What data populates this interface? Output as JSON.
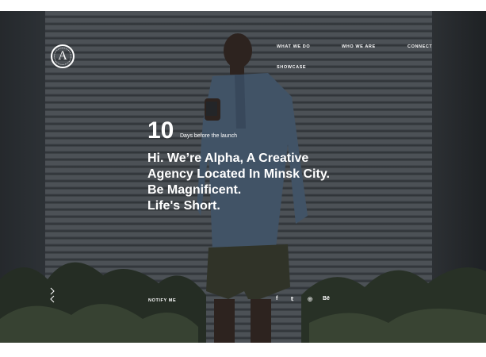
{
  "brand": {
    "logo_letter": "A"
  },
  "nav": {
    "items": [
      {
        "label": "WHAT WE DO"
      },
      {
        "label": "WHO WE ARE"
      },
      {
        "label": "CONNECT"
      },
      {
        "label": "SHOWCASE"
      }
    ]
  },
  "countdown": {
    "number": "10",
    "label": "Days before the launch"
  },
  "headline": {
    "lines": [
      "Hi. We’re Alpha, A Creative",
      "Agency Located In Minsk City.",
      "Be Magnificent.",
      "Life's Short."
    ]
  },
  "footer": {
    "notify_label": "NOTIFY ME",
    "social": [
      {
        "icon": "facebook-icon",
        "glyph": "f"
      },
      {
        "icon": "twitter-icon",
        "glyph": "𝕥"
      },
      {
        "icon": "instagram-icon",
        "glyph": "◎"
      },
      {
        "icon": "behance-icon",
        "glyph": "Bē"
      }
    ]
  },
  "slider": {
    "next_icon": "chevron-right-icon",
    "prev_icon": "chevron-left-icon"
  },
  "colors": {
    "text": "#ffffff",
    "overlay": "#141619"
  }
}
